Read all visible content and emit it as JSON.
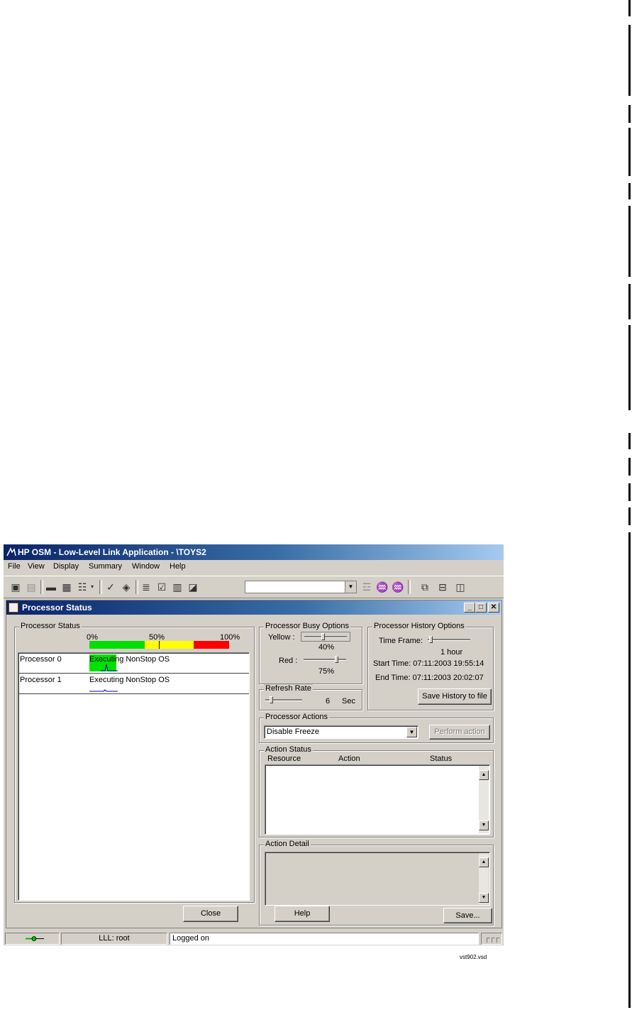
{
  "app": {
    "title": "HP OSM - Low-Level Link Application - \\TOYS2",
    "menu": [
      "File",
      "View",
      "Display",
      "Summary",
      "Window",
      "Help"
    ],
    "toolbar_combo_value": ""
  },
  "window": {
    "title": "Processor Status",
    "controls": {
      "minimize": "_",
      "maximize": "□",
      "close": "✕"
    }
  },
  "processor_status": {
    "group_label": "Processor Status",
    "scale_labels": [
      "0%",
      "50%",
      "100%"
    ],
    "scale_colors": {
      "low": "#00e000",
      "mid": "#ffff00",
      "high": "#ff0000"
    },
    "processors": [
      {
        "name": "Processor 0",
        "status": "Executing NonStop OS"
      },
      {
        "name": "Processor 1",
        "status": "Executing NonStop OS"
      }
    ]
  },
  "busy_options": {
    "group_label": "Processor Busy Options",
    "yellow_label": "Yellow :",
    "yellow_value": "40%",
    "red_label": "Red :",
    "red_value": "75%"
  },
  "history_options": {
    "group_label": "Processor History Options",
    "time_frame_label": "Time Frame:",
    "time_frame_value": "1 hour",
    "start_time": "Start Time: 07:11:2003 19:55:14",
    "end_time": "End Time: 07:11:2003 20:02:07",
    "save_button": "Save History to file"
  },
  "refresh_rate": {
    "group_label": "Refresh Rate",
    "value": "6",
    "unit": "Sec"
  },
  "actions": {
    "group_label": "Processor Actions",
    "selected": "Disable Freeze",
    "perform_button": "Perform action"
  },
  "action_status": {
    "group_label": "Action Status",
    "columns": [
      "Resource",
      "Action",
      "Status"
    ]
  },
  "action_detail": {
    "group_label": "Action Detail",
    "save_button": "Save..."
  },
  "bottom_buttons": {
    "close": "Close",
    "help": "Help"
  },
  "statusbar": {
    "user": "LLL: root",
    "message": "Logged on"
  },
  "figure_code": "vst902.vsd"
}
